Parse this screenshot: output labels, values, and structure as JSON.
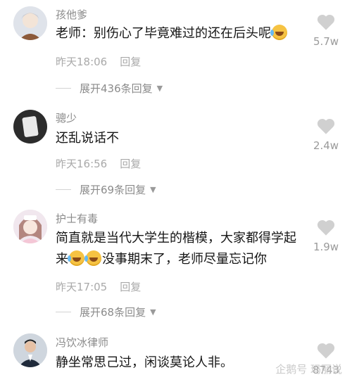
{
  "comments": [
    {
      "name": "孩他爹",
      "text_before": "老师：别伤心了毕竟难过的还在后头呢",
      "text_after": "",
      "time": "昨天18:06",
      "reply": "回复",
      "expand": "展开436条回复",
      "likes": "5.7w"
    },
    {
      "name": "骢少",
      "text_before": "还乱说话不",
      "text_after": "",
      "time": "昨天16:56",
      "reply": "回复",
      "expand": "展开69条回复",
      "likes": "2.4w"
    },
    {
      "name": "护士有毒",
      "text_before": "简直就是当代大学生的楷模，大家都得学起来",
      "text_after": "没事期末了，老师尽量忘记你",
      "time": "昨天17:05",
      "reply": "回复",
      "expand": "展开68条回复",
      "likes": "1.9w"
    },
    {
      "name": "冯饮冰律师",
      "text_before": "静坐常思己过，闲谈莫论人非。",
      "text_after": "",
      "likes": "8743"
    }
  ],
  "watermark": "企鹅号 玛丽说",
  "icons": {
    "like": "heart-icon",
    "expand": "chevron-down-icon",
    "emoji": "laughing-crying-emoji-icon"
  },
  "colors": {
    "name": "#8b8b8b",
    "text": "#161616",
    "meta": "#a9a9a9",
    "heart": "#d0d0d0"
  }
}
